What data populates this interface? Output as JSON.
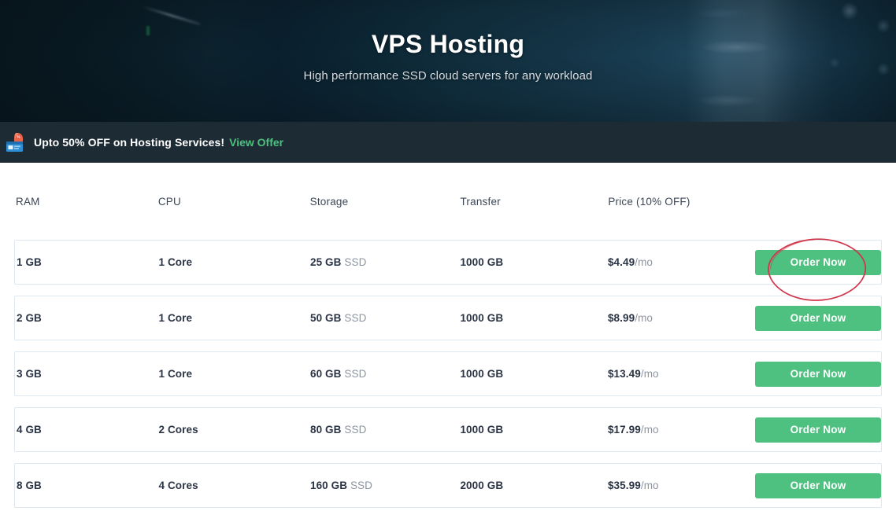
{
  "hero": {
    "title": "VPS Hosting",
    "subtitle": "High performance SSD cloud servers for any workload"
  },
  "promo": {
    "icon": "discount-tag-icon",
    "text": "Upto 50% OFF on Hosting Services!",
    "link_label": "View Offer"
  },
  "table": {
    "columns": [
      "RAM",
      "CPU",
      "Storage",
      "Transfer",
      "Price (10% OFF)"
    ],
    "action_label": "Order Now",
    "rows": [
      {
        "ram": "1 GB",
        "cpu": "1 Core",
        "storage_value": "25 GB",
        "storage_type": "SSD",
        "transfer": "1000 GB",
        "price": "$4.49",
        "price_period": "/mo",
        "action": "Order Now"
      },
      {
        "ram": "2 GB",
        "cpu": "1 Core",
        "storage_value": "50 GB",
        "storage_type": "SSD",
        "transfer": "1000 GB",
        "price": "$8.99",
        "price_period": "/mo",
        "action": "Order Now"
      },
      {
        "ram": "3 GB",
        "cpu": "1 Core",
        "storage_value": "60 GB",
        "storage_type": "SSD",
        "transfer": "1000 GB",
        "price": "$13.49",
        "price_period": "/mo",
        "action": "Order Now"
      },
      {
        "ram": "4 GB",
        "cpu": "2 Cores",
        "storage_value": "80 GB",
        "storage_type": "SSD",
        "transfer": "1000 GB",
        "price": "$17.99",
        "price_period": "/mo",
        "action": "Order Now"
      },
      {
        "ram": "8 GB",
        "cpu": "4 Cores",
        "storage_value": "160 GB",
        "storage_type": "SSD",
        "transfer": "2000 GB",
        "price": "$35.99",
        "price_period": "/mo",
        "action": "Order Now"
      }
    ]
  },
  "annotation": {
    "shape": "ellipse",
    "target": "order-now-button-row-1",
    "color": "#d1344a"
  },
  "colors": {
    "accent_green": "#4ec07f",
    "promo_bar": "#1d2b35",
    "hero_dark": "#0d1d28",
    "row_border": "#dfe7f0",
    "text_primary": "#2b3445",
    "text_muted": "#8d95a1",
    "annotation_red": "#d1344a"
  }
}
